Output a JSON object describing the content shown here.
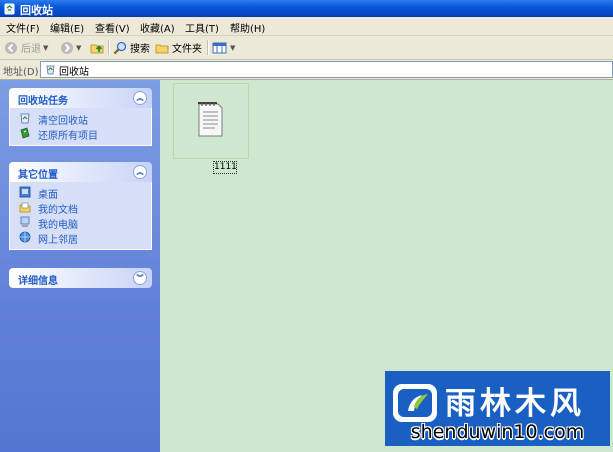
{
  "window": {
    "title": "回收站"
  },
  "menu": {
    "items": [
      {
        "label": "文件(F)"
      },
      {
        "label": "编辑(E)"
      },
      {
        "label": "查看(V)"
      },
      {
        "label": "收藏(A)"
      },
      {
        "label": "工具(T)"
      },
      {
        "label": "帮助(H)"
      }
    ]
  },
  "toolbar": {
    "back_label": "后退",
    "search_label": "搜索",
    "folders_label": "文件夹"
  },
  "address": {
    "label": "地址(D)",
    "value": "回收站"
  },
  "tasks_panel": {
    "title": "回收站任务",
    "items": [
      {
        "label": "清空回收站",
        "icon": "recycle-bin-icon"
      },
      {
        "label": "还原所有项目",
        "icon": "restore-icon"
      }
    ]
  },
  "places_panel": {
    "title": "其它位置",
    "items": [
      {
        "label": "桌面",
        "icon": "desktop-icon"
      },
      {
        "label": "我的文档",
        "icon": "my-documents-icon"
      },
      {
        "label": "我的电脑",
        "icon": "my-computer-icon"
      },
      {
        "label": "网上邻居",
        "icon": "network-places-icon"
      }
    ]
  },
  "details_panel": {
    "title": "详细信息"
  },
  "files": [
    {
      "name": "1111",
      "icon": "text-document-icon"
    }
  ],
  "watermark": {
    "name": "雨林木风",
    "site": "shenduwin10.com"
  },
  "colors": {
    "title_bar": "#0a57d6",
    "left_pane": "#6181d8",
    "content_bg": "#cfe7cf",
    "link": "#215dc6"
  }
}
